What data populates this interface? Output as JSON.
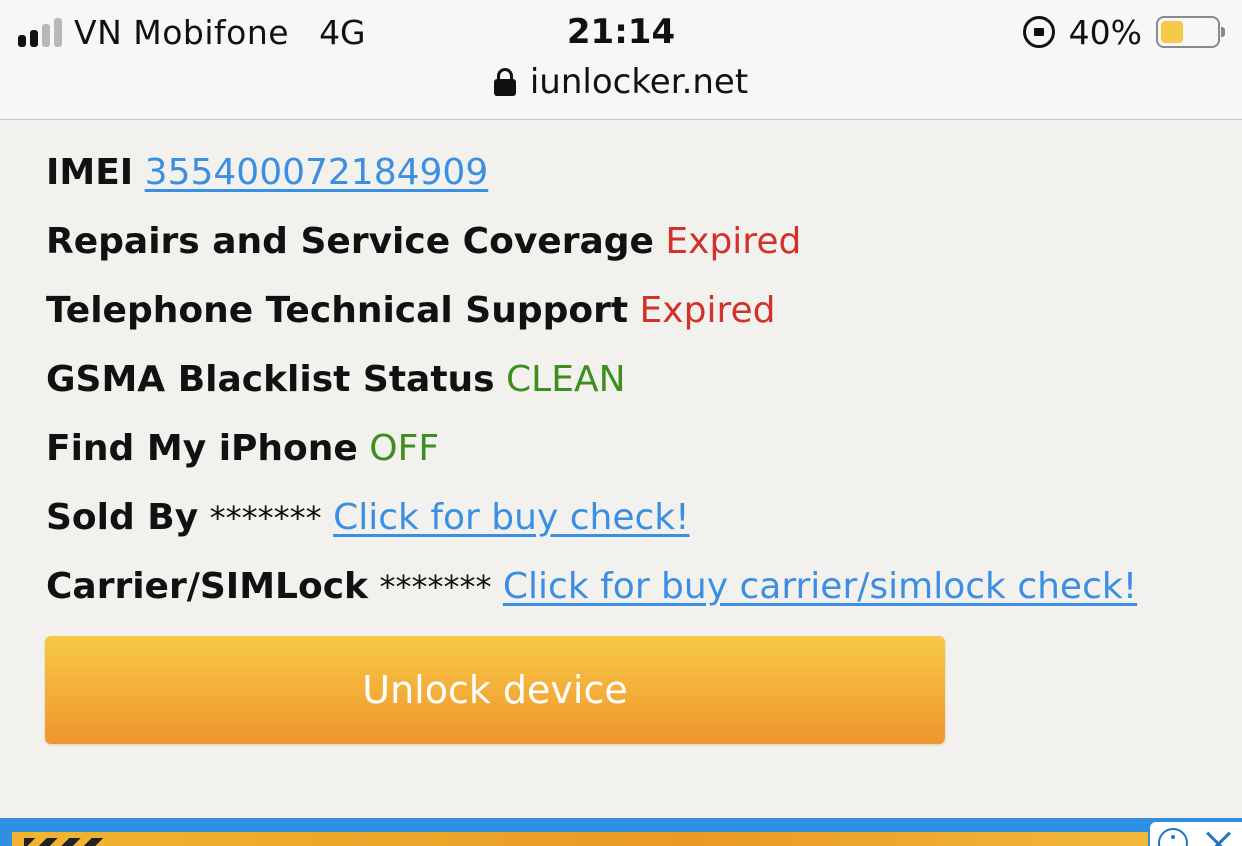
{
  "status_bar": {
    "carrier": "VN Mobifone",
    "network": "4G",
    "time": "21:14",
    "battery_text": "40%",
    "battery_level": 0.4,
    "signal_bars_active": 2,
    "signal_bars_total": 4,
    "icons": [
      "signal-icon",
      "orientation-lock-icon",
      "battery-icon"
    ]
  },
  "browser": {
    "url": "iunlocker.net",
    "icons": [
      "lock-icon"
    ]
  },
  "details": {
    "imei_label": "IMEI",
    "imei_value": "355400072184909",
    "repairs_label": "Repairs and Service Coverage",
    "repairs_value": "Expired",
    "phone_support_label": "Telephone Technical Support",
    "phone_support_value": "Expired",
    "gsma_label": "GSMA Blacklist Status",
    "gsma_value": "CLEAN",
    "fmi_label": "Find My iPhone",
    "fmi_value": "OFF",
    "sold_by_label": "Sold By",
    "sold_by_mask": "*******",
    "sold_by_link": "Click for buy check!",
    "carrier_label": "Carrier/SIMLock",
    "carrier_mask": "*******",
    "carrier_link": "Click for buy carrier/simlock check!"
  },
  "actions": {
    "unlock_label": "Unlock device"
  },
  "ad": {
    "icons": [
      "info-icon",
      "close-icon"
    ]
  },
  "colors": {
    "expired": "#d0332b",
    "ok": "#3e8e1f",
    "link": "#3b8fe3",
    "button_top": "#f7c846",
    "button_bottom": "#f0962d",
    "battery_fill": "#f7c948"
  }
}
